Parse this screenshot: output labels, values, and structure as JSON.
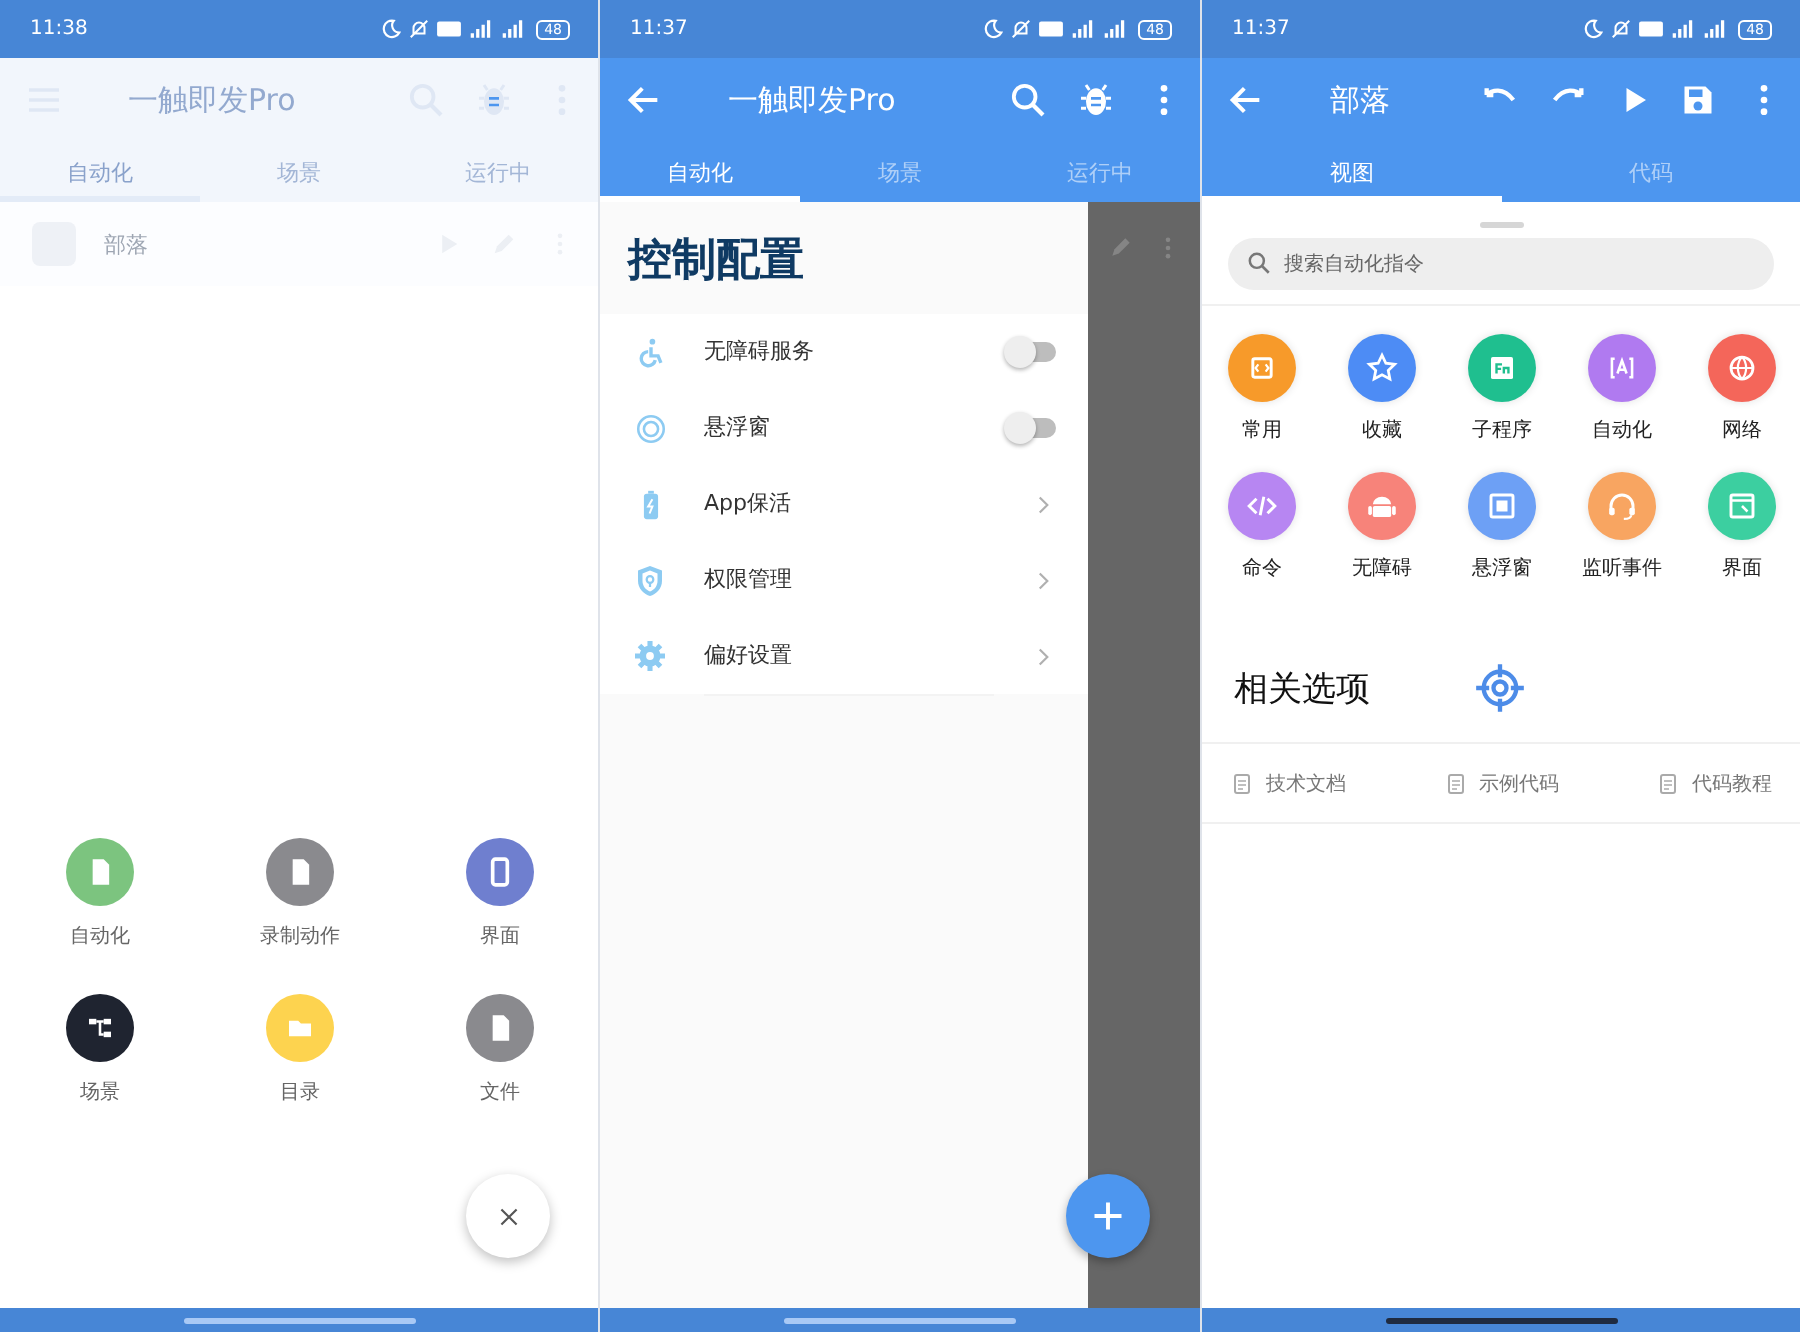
{
  "left_screen": {
    "status_bar": {
      "time": "11:38",
      "battery": "48"
    },
    "app_bar": {
      "title": "一触即发Pro"
    },
    "tabs": [
      {
        "label": "自动化",
        "selected": true
      },
      {
        "label": "场景",
        "selected": false
      },
      {
        "label": "运行中",
        "selected": false
      }
    ],
    "list_items": [
      {
        "name": "部落"
      }
    ],
    "create_options": [
      {
        "label": "自动化",
        "color": "#7cc47f"
      },
      {
        "label": "录制动作",
        "color": "#8a8a8e"
      },
      {
        "label": "界面",
        "color": "#6f7fcf"
      },
      {
        "label": "场景",
        "color": "#1f2430"
      },
      {
        "label": "目录",
        "color": "#fdd34f"
      },
      {
        "label": "文件",
        "color": "#8a8a8e"
      }
    ]
  },
  "middle_screen": {
    "status_bar": {
      "time": "11:37",
      "battery": "48"
    },
    "app_bar": {
      "title": "一触即发Pro"
    },
    "tabs": [
      {
        "label": "自动化",
        "selected": true
      },
      {
        "label": "场景",
        "selected": false
      },
      {
        "label": "运行中",
        "selected": false
      }
    ],
    "drawer": {
      "title": "控制配置",
      "items": [
        {
          "label": "无障碍服务",
          "kind": "toggle",
          "on": false
        },
        {
          "label": "悬浮窗",
          "kind": "toggle",
          "on": false
        },
        {
          "label": "App保活",
          "kind": "link"
        },
        {
          "label": "权限管理",
          "kind": "link"
        },
        {
          "label": "偏好设置",
          "kind": "link"
        }
      ]
    }
  },
  "right_screen": {
    "status_bar": {
      "time": "11:37",
      "battery": "48"
    },
    "app_bar": {
      "title": "部落"
    },
    "tabs": [
      {
        "label": "视图",
        "selected": true
      },
      {
        "label": "代码",
        "selected": false
      }
    ],
    "search": {
      "placeholder": "搜索自动化指令"
    },
    "categories": [
      {
        "label": "常用",
        "color": "#f79a2a"
      },
      {
        "label": "收藏",
        "color": "#4d8cf5"
      },
      {
        "label": "子程序",
        "color": "#1fbf8f"
      },
      {
        "label": "自动化",
        "color": "#b07af0"
      },
      {
        "label": "网络",
        "color": "#f4665a"
      },
      {
        "label": "命令",
        "color": "#b786f2"
      },
      {
        "label": "无障碍",
        "color": "#f7837a"
      },
      {
        "label": "悬浮窗",
        "color": "#6da0f5"
      },
      {
        "label": "监听事件",
        "color": "#f8a561"
      },
      {
        "label": "界面",
        "color": "#3ccfa0"
      }
    ],
    "related": {
      "title": "相关选项",
      "links": [
        "技术文档",
        "示例代码",
        "代码教程"
      ]
    }
  }
}
